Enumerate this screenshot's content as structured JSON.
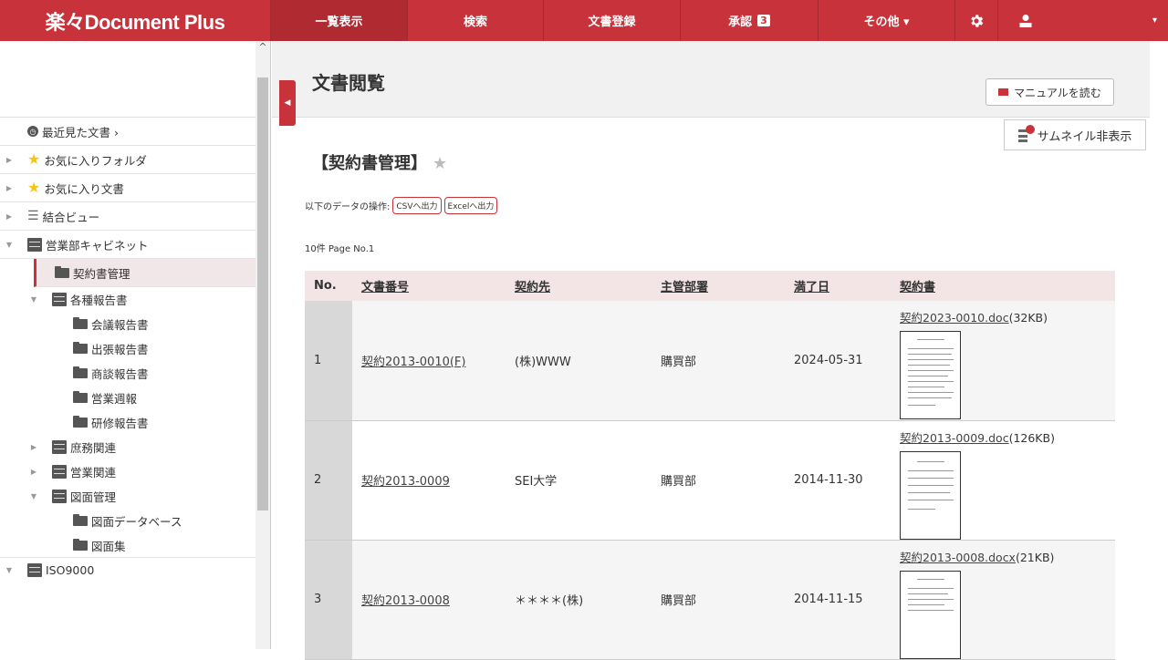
{
  "app": {
    "logo": "楽々Document Plus"
  },
  "nav": {
    "items": [
      {
        "label": "一覧表示",
        "width": 150,
        "active": true
      },
      {
        "label": "検索",
        "width": 149
      },
      {
        "label": "文書登録",
        "width": 150
      },
      {
        "label": "承認",
        "width": 151,
        "count": "3"
      },
      {
        "label": "その他 ▾",
        "width": 150
      }
    ]
  },
  "sidebar": {
    "recent": "最近見た文書 ›",
    "fav_folder": "お気に入りフォルダ",
    "fav_doc": "お気に入り文書",
    "combined_view": "結合ビュー",
    "sales_cabinet": "営業部キャビネット",
    "contract_mgmt": "契約書管理",
    "reports": "各種報告書",
    "meeting_report": "会議報告書",
    "trip_report": "出張報告書",
    "negotiation_report": "商談報告書",
    "weekly_report": "営業週報",
    "training_report": "研修報告書",
    "general_affairs": "庶務関連",
    "sales_related": "営業関連",
    "drawing_mgmt": "図面管理",
    "drawing_db": "図面データベース",
    "drawing_collection": "図面集",
    "iso": "ISO9000"
  },
  "main": {
    "title": "文書閲覧",
    "manual_button": "マニュアルを読む",
    "thumbnail_toggle": "サムネイル非表示",
    "folder_title": "【契約書管理】",
    "ops_label": "以下のデータの操作:",
    "csv_button": "CSVへ出力",
    "excel_button": "Excelへ出力",
    "page_info": "10件 Page No.1"
  },
  "table": {
    "headers": {
      "no": "No.",
      "doc_no": "文書番号",
      "party": "契約先",
      "dept": "主管部署",
      "expiry": "満了日",
      "contract": "契約書"
    },
    "rows": [
      {
        "no": "1",
        "doc_no": "契約2013-0010(F)",
        "party": "(株)WWW",
        "dept": "購買部",
        "expiry": "2024-05-31",
        "file_name": "契約2023-0010.doc",
        "file_size": "(32KB)"
      },
      {
        "no": "2",
        "doc_no": "契約2013-0009",
        "party": "SEI大学",
        "dept": "購買部",
        "expiry": "2014-11-30",
        "file_name": "契約2013-0009.doc",
        "file_size": "(126KB)"
      },
      {
        "no": "3",
        "doc_no": "契約2013-0008",
        "party": "＊＊＊＊(株)",
        "dept": "購買部",
        "expiry": "2014-11-15",
        "file_name": "契約2013-0008.docx",
        "file_size": "(21KB)"
      }
    ]
  },
  "colors": {
    "brand": "#c8333b",
    "header_row": "#f3e4e5",
    "selected": "#f1e7e8"
  },
  "icons": [
    "gear-icon",
    "user-icon",
    "star-icon",
    "folder-icon",
    "cabinet-icon",
    "clock-icon",
    "list-icon",
    "book-icon",
    "thumbnail-icon"
  ]
}
